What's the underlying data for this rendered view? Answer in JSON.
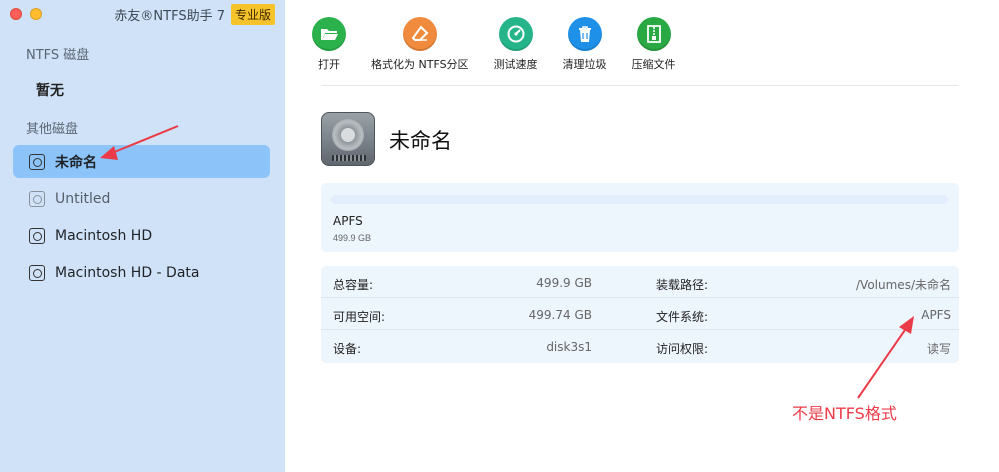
{
  "window": {
    "app_title": "赤友®NTFS助手 7",
    "edition_badge": "专业版"
  },
  "sidebar": {
    "ntfs_section_label": "NTFS 磁盘",
    "ntfs_empty_label": "暂无",
    "other_section_label": "其他磁盘",
    "disks": [
      {
        "label": "未命名",
        "selected": true
      },
      {
        "label": "Untitled",
        "selected": false
      },
      {
        "label": "Macintosh HD",
        "selected": false
      },
      {
        "label": "Macintosh HD - Data",
        "selected": false
      }
    ]
  },
  "toolbar": {
    "open_label": "打开",
    "format_label": "格式化为 NTFS分区",
    "speed_label": "测试速度",
    "clean_label": "清理垃圾",
    "compress_label": "压缩文件"
  },
  "disk": {
    "name": "未命名",
    "filesystem": "APFS",
    "size": "499.9 GB",
    "used_fraction": 0.0
  },
  "info": {
    "total_label": "总容量:",
    "total_value": "499.9 GB",
    "available_label": "可用空间:",
    "available_value": "499.74 GB",
    "device_label": "设备:",
    "device_value": "disk3s1",
    "mount_label": "装载路径:",
    "mount_value": "/Volumes/未命名",
    "fs_label": "文件系统:",
    "fs_value": "APFS",
    "access_label": "访问权限:",
    "access_value": "读写"
  },
  "annotation": {
    "text": "不是NTFS格式",
    "color": "#ec3b48"
  },
  "colors": {
    "sidebar_bg": "#cfe2f7",
    "selected_bg": "#8cc4f9",
    "open": "#2bb24c",
    "format": "#f08a3c",
    "speed": "#26b58a",
    "clean": "#1e90e8",
    "compress": "#2aa843"
  }
}
